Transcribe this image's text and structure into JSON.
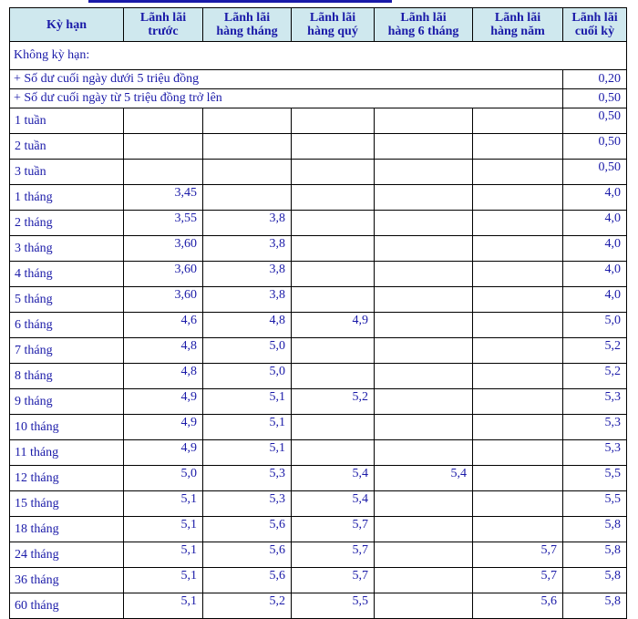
{
  "headers": [
    "Kỳ hạn",
    "Lãnh lãi trước",
    "Lãnh lãi hàng tháng",
    "Lãnh lãi hàng quý",
    "Lãnh lãi hàng 6 tháng",
    "Lãnh lãi hàng năm",
    "Lãnh lãi cuối kỳ"
  ],
  "header_lines": [
    [
      "Kỳ hạn"
    ],
    [
      "Lãnh lãi",
      "trước"
    ],
    [
      "Lãnh lãi",
      "hàng tháng"
    ],
    [
      "Lãnh lãi",
      "hàng quý"
    ],
    [
      "Lãnh lãi",
      "hàng 6 tháng"
    ],
    [
      "Lãnh lãi",
      "hàng năm"
    ],
    [
      "Lãnh lãi",
      "cuối kỳ"
    ]
  ],
  "demand": {
    "label": "Không kỳ hạn:",
    "items": [
      {
        "label": "+ Số dư cuối ngày dưới 5 triệu đồng",
        "rate": "0,20"
      },
      {
        "label": "+ Số dư cuối ngày từ 5 triệu đồng trở lên",
        "rate": "0,50"
      }
    ]
  },
  "rows": [
    [
      "1 tuần",
      "",
      "",
      "",
      "",
      "",
      "0,50"
    ],
    [
      "2 tuần",
      "",
      "",
      "",
      "",
      "",
      "0,50"
    ],
    [
      "3 tuần",
      "",
      "",
      "",
      "",
      "",
      "0,50"
    ],
    [
      "1 tháng",
      "3,45",
      "",
      "",
      "",
      "",
      "4,0"
    ],
    [
      "2 tháng",
      "3,55",
      "3,8",
      "",
      "",
      "",
      "4,0"
    ],
    [
      "3 tháng",
      "3,60",
      "3,8",
      "",
      "",
      "",
      "4,0"
    ],
    [
      "4 tháng",
      "3,60",
      "3,8",
      "",
      "",
      "",
      "4,0"
    ],
    [
      "5 tháng",
      "3,60",
      "3,8",
      "",
      "",
      "",
      "4,0"
    ],
    [
      "6 tháng",
      "4,6",
      "4,8",
      "4,9",
      "",
      "",
      "5,0"
    ],
    [
      "7 tháng",
      "4,8",
      "5,0",
      "",
      "",
      "",
      "5,2"
    ],
    [
      "8 tháng",
      "4,8",
      "5,0",
      "",
      "",
      "",
      "5,2"
    ],
    [
      "9 tháng",
      "4,9",
      "5,1",
      "5,2",
      "",
      "",
      "5,3"
    ],
    [
      "10 tháng",
      "4,9",
      "5,1",
      "",
      "",
      "",
      "5,3"
    ],
    [
      "11 tháng",
      "4,9",
      "5,1",
      "",
      "",
      "",
      "5,3"
    ],
    [
      "12 tháng",
      "5,0",
      "5,3",
      "5,4",
      "5,4",
      "",
      "5,5"
    ],
    [
      "15 tháng",
      "5,1",
      "5,3",
      "5,4",
      "",
      "",
      "5,5"
    ],
    [
      "18 tháng",
      "5,1",
      "5,6",
      "5,7",
      "",
      "",
      "5,8"
    ],
    [
      "24 tháng",
      "5,1",
      "5,6",
      "5,7",
      "",
      "5,7",
      "5,8"
    ],
    [
      "36 tháng",
      "5,1",
      "5,6",
      "5,7",
      "",
      "5,7",
      "5,8"
    ],
    [
      "60 tháng",
      "5,1",
      "5,2",
      "5,5",
      "",
      "5,6",
      "5,8"
    ]
  ],
  "colors": {
    "text": "#1a1aa8",
    "header_bg": "#cfe8ee",
    "border": "#000000"
  }
}
